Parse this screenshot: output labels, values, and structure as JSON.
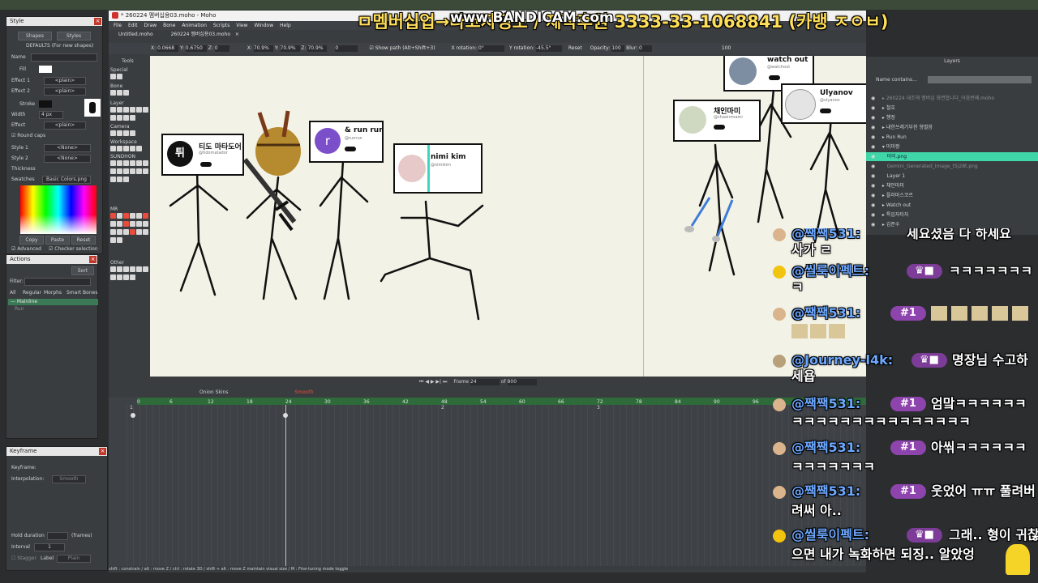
{
  "watermark": {
    "text": "ㅁ멤버십업→타코자쟁소 / 제작후원 3333-33-1068841 (카뱅 ㅈㅇㅂ)",
    "logo": "www.BANDICAM.com"
  },
  "style_panel": {
    "title": "Style",
    "tab_shapes": "Shapes",
    "tab_styles": "Styles",
    "defaults": "DEFAULTS (For new shapes)",
    "name_label": "Name",
    "fill_label": "Fill",
    "effect1_label": "Effect 1",
    "effect1_value": "<plain>",
    "effect2_label": "Effect 2",
    "effect2_value": "<plain>",
    "stroke_label": "Stroke",
    "width_label": "Width",
    "width_value": "4 px",
    "effect_label": "Effect",
    "effect_value": "<plain>",
    "round_caps": "Round caps",
    "style1_label": "Style 1",
    "style1_value": "<None>",
    "style2_label": "Style 2",
    "style2_value": "<None>",
    "thickness_label": "Thickness",
    "swatches_label": "Swatches",
    "swatches_value": "Basic Colors.png",
    "copy": "Copy",
    "paste": "Paste",
    "reset": "Reset",
    "advanced": "Advanced",
    "checker": "Checker selection"
  },
  "actions_panel": {
    "title": "Actions",
    "sort": "Sort",
    "filter_label": "Filter:",
    "tabs": [
      "All",
      "Regular",
      "Morphs",
      "Smart Bones"
    ],
    "selected_item": "— Mainline",
    "item2": "Run"
  },
  "keyframe_panel": {
    "title": "Keyframe",
    "keyframe_label": "Keyframe:",
    "interpolation_label": "Interpolation:",
    "interpolation_value": "Smooth",
    "hold_label": "Hold duration",
    "hold_unit": "(frames)",
    "interval_label": "Interval",
    "interval_value": "1",
    "stagger_label": "Stagger",
    "label_label": "Label",
    "label_value": "Plain"
  },
  "moho": {
    "title": "* 260224 멤버십용03.moho - Moho",
    "menu": [
      "File",
      "Edit",
      "Draw",
      "Bone",
      "Animation",
      "Scripts",
      "View",
      "Window",
      "Help"
    ],
    "tabs": [
      "Untitled.moho",
      "260224 멤버십용03.moho"
    ],
    "tool_options": {
      "x_label": "X:",
      "x_value": "0.0668",
      "y_label": "Y:",
      "y_value": "0.6750",
      "z_label": "Z:",
      "z_value": "0",
      "sx_label": "X:",
      "sx_value": "70.9%",
      "sy_label": "Y:",
      "sy_value": "70.9%",
      "sz_label": "Z:",
      "sz_value": "70.9%",
      "rot_value": "0",
      "show_path": "Show path (Alt+Shift+3)",
      "xrot_label": "X rotation:",
      "xrot_value": "0°",
      "yrot_label": "Y rotation:",
      "yrot_value": "-45.5°",
      "reset": "Reset",
      "opacity_label": "Opacity:",
      "opacity_value": "100",
      "blur_label": "Blur:",
      "blur_value": "0",
      "zoom_value": "100"
    },
    "tools": {
      "title": "Tools",
      "sections": [
        "Special",
        "Bone",
        "Layer",
        "Camera",
        "Workspace",
        "SUNDHON",
        "MR",
        "Other"
      ]
    },
    "playback": {
      "frame_label": "Frame",
      "frame_value": "24",
      "of_label": "of",
      "of_value": "800"
    },
    "timeline": {
      "onion_skins": "Onion Skins",
      "smooth": "Smooth",
      "ruler": [
        "0",
        "6",
        "12",
        "18",
        "24",
        "30",
        "36",
        "42",
        "48",
        "54",
        "60",
        "66",
        "72",
        "78",
        "84",
        "90",
        "96"
      ],
      "marks": [
        "1",
        "2",
        "3"
      ]
    },
    "status": "shift : constrain / alt : move Z / ctrl : rotate 3D / shift + alt : move Z maintain visual size / M : Fine-tuning mode toggle"
  },
  "layers_panel": {
    "title": "Layers",
    "filter": "Name contains...",
    "items": [
      "260224 대조해 멤버십 화면합니다_어음번째.moho",
      "철호",
      "행정",
      "내한쓰레기부현 형별함",
      "Run Run",
      "미미짱",
      "미미.png",
      "Gemini_Generated_Image_t5j28t.png",
      "Layer 1",
      "채인마미",
      "플러마스코르",
      "Watch out",
      "특임자타자",
      "김준수"
    ]
  },
  "canvas": {
    "signs": [
      {
        "name": "티도 마타도어",
        "handle": "@tidomatador"
      },
      {
        "name": "& run run",
        "handle": "@runrun",
        "avatar": "r"
      },
      {
        "name": "nimi kim",
        "handle": "@nimikim"
      },
      {
        "name": "채인마미",
        "handle": "@chaeinmami"
      },
      {
        "name": "watch out",
        "handle": "@watchout"
      },
      {
        "name": "Ulyanov",
        "handle": "@ulyanov"
      }
    ]
  },
  "chat": [
    {
      "user": "@짹짹531:",
      "text": "세요셨음 다 하세요",
      "line2": "사가 ㄹ"
    },
    {
      "user": "@씰룩이펙트:",
      "text": "ㅋㅋㅋㅋㅋㅋㅋ",
      "line2": "ㅋ"
    },
    {
      "user": "@짹짹531:",
      "badge": "#1"
    },
    {
      "user": "@Journey-l4k:",
      "text": "명장님 수고하",
      "line2": "세욥"
    },
    {
      "user": "@짹짹531:",
      "badge": "#1",
      "text": "엄맠ㅋㅋㅋㅋㅋㅋ",
      "line2": "ㅋㅋㅋㅋㅋㅋㅋㅋㅋㅋㅋㅋㅋㅋㅋ"
    },
    {
      "user": "@짹짹531:",
      "badge": "#1",
      "text": "아씪ㅋㅋㅋㅋㅋㅋ",
      "line2": "ㅋㅋㅋㅋㅋㅋㅋ"
    },
    {
      "user": "@짹짹531:",
      "badge": "#1",
      "text": "웃었어 ㅠㅠ 풀려버",
      "line2": "려써 아.."
    },
    {
      "user": "@씰룩이펙트:",
      "text": "그래.. 형이 귀찮",
      "line2": "으면 내가 녹화하면 되징.. 알았엉"
    }
  ]
}
